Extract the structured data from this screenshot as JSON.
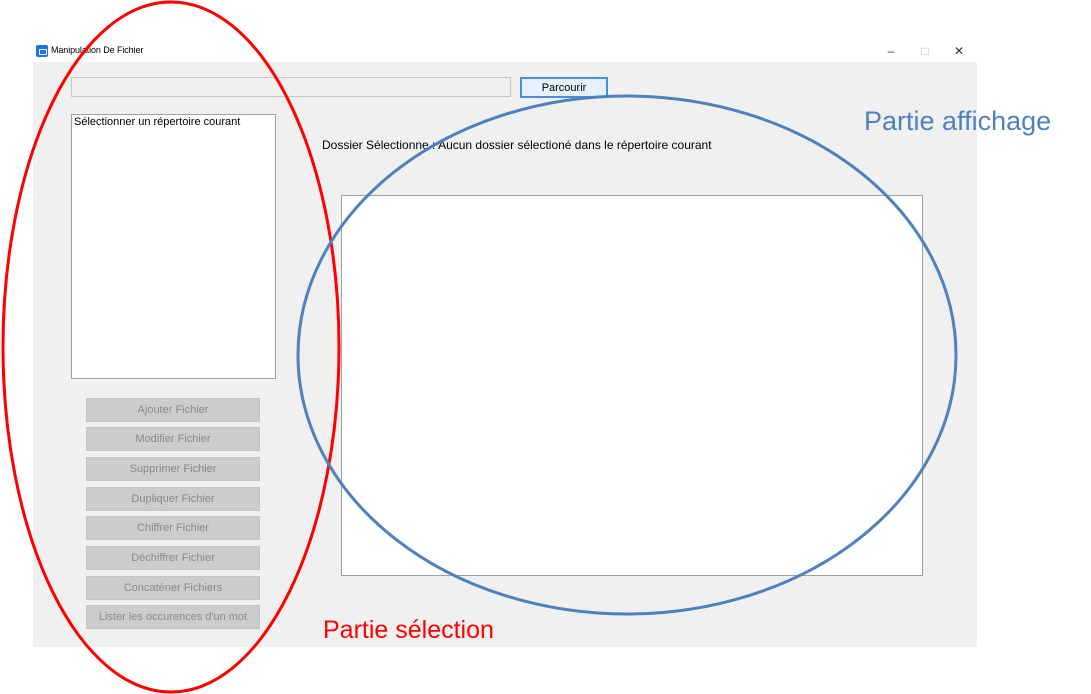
{
  "window": {
    "title": "Manipulation De Fichier",
    "controls": {
      "minimize": "–",
      "maximize": "□",
      "close": "✕"
    }
  },
  "toolbar": {
    "path_value": "",
    "browse_label": "Parcourir"
  },
  "directory_list": {
    "items": [
      "Sélectionner un répertoire courant"
    ]
  },
  "main": {
    "selected_folder_text": "Dossier Sélectionne : Aucun dossier sélectioné dans le répertoire courant"
  },
  "actions": [
    "Ajouter Fichier",
    "Modifier Fichier",
    "Supprimer Fichier",
    "Dupliquer Fichier",
    "Chiffrer Fichier",
    "Déchiffrer Fichier",
    "Concaténer Fichiers",
    "Lister les occurences d'un mot"
  ],
  "annotations": {
    "display_part": {
      "label": "Partie affichage",
      "color": "#4f81bd"
    },
    "selection_part": {
      "label": "Partie sélection",
      "color": "#ff0000"
    }
  }
}
